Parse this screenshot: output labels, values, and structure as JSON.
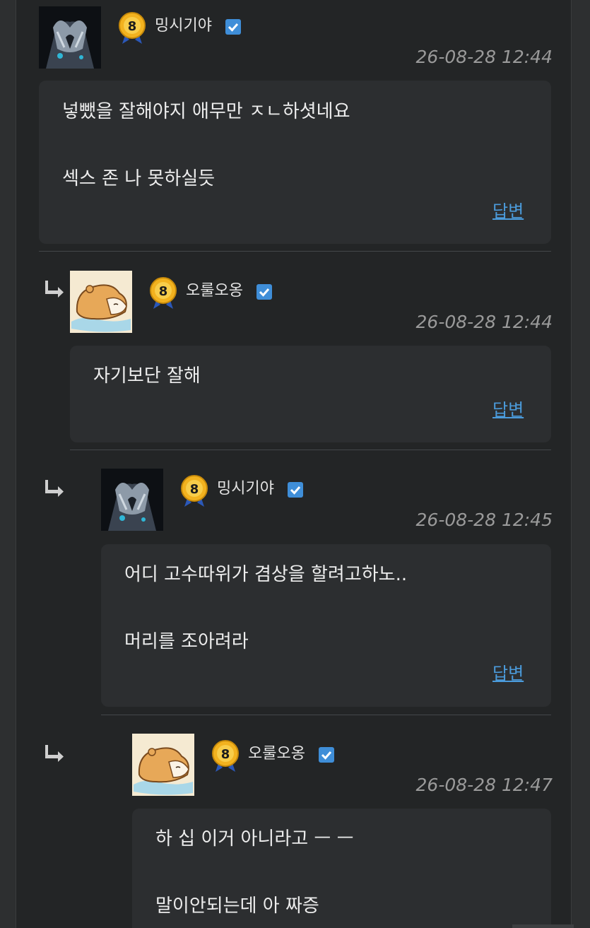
{
  "comments": [
    {
      "user": "밍시기야",
      "level": "8",
      "time": "26-08-28 12:44",
      "lines": [
        "넣뺐을 잘해야지 애무만 ㅈㄴ하셧네요",
        "섹스 존 나 못하실듯"
      ],
      "reply_label": "답변",
      "avatar": "dark-hands-avatar"
    },
    {
      "user": "오룰오옹",
      "level": "8",
      "time": "26-08-28 12:44",
      "lines": [
        "자기보단 잘해"
      ],
      "reply_label": "답변",
      "avatar": "sleeping-hamster-avatar"
    },
    {
      "user": "밍시기야",
      "level": "8",
      "time": "26-08-28 12:45",
      "lines": [
        "어디 고수따위가 겸상을 할려고하노..",
        "머리를 조아려라"
      ],
      "reply_label": "답변",
      "avatar": "dark-hands-avatar"
    },
    {
      "user": "오룰오옹",
      "level": "8",
      "time": "26-08-28 12:47",
      "lines": [
        "하 십 이거 아니라고 ㅡ ㅡ",
        "말이안되는데 아 짜증"
      ],
      "reply_label": "",
      "avatar": "sleeping-hamster-avatar"
    }
  ],
  "colors": {
    "background": "#232526",
    "bubble": "#2c2e30",
    "link": "#4b9bdb",
    "verified": "#3f8ed8",
    "badge": "#f2b21f"
  }
}
